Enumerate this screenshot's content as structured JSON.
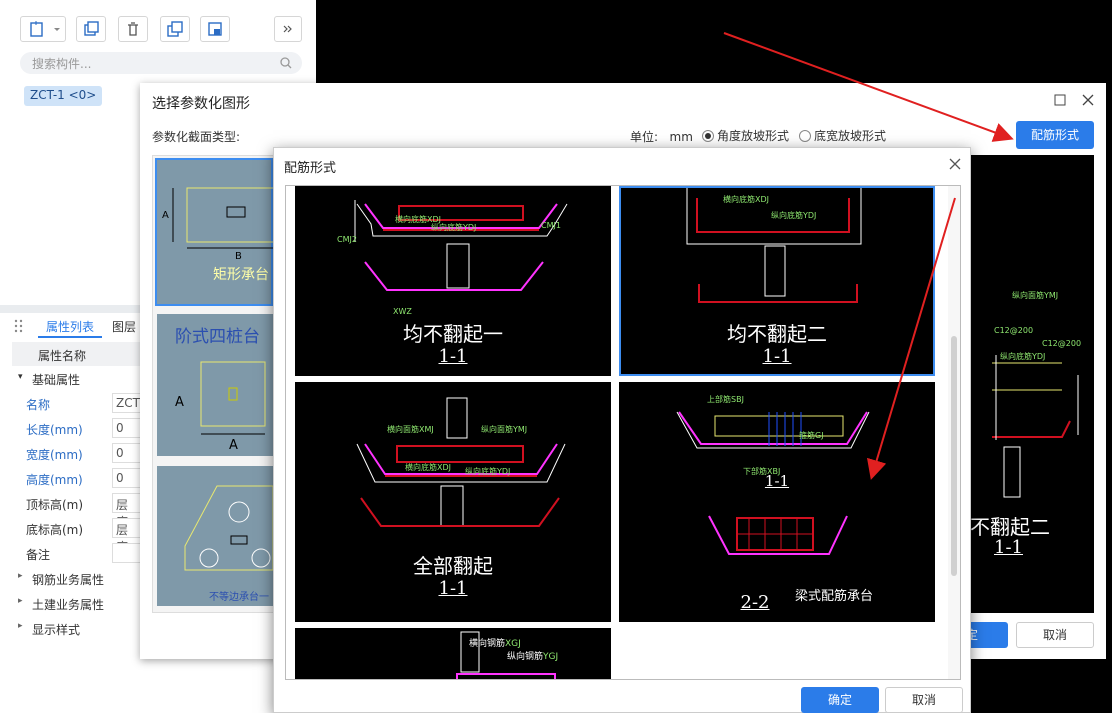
{
  "left_panel": {
    "search_placeholder": "搜索构件...",
    "component": "ZCT-1 <0>",
    "tabs": [
      "属性列表",
      "图层"
    ],
    "prop_header": "属性名称",
    "group_basic": "基础属性",
    "props": [
      {
        "name": "名称",
        "value": "ZCT"
      },
      {
        "name": "长度(mm)",
        "value": "0"
      },
      {
        "name": "宽度(mm)",
        "value": "0"
      },
      {
        "name": "高度(mm)",
        "value": "0"
      },
      {
        "name": "顶标高(m)",
        "value": "层底"
      },
      {
        "name": "底标高(m)",
        "value": "层底"
      },
      {
        "name": "备注",
        "value": ""
      }
    ],
    "groups": [
      "钢筋业务属性",
      "土建业务属性",
      "显示样式"
    ]
  },
  "outer_dialog": {
    "title": "选择参数化图形",
    "section_type_label": "参数化截面类型:",
    "unit_label": "单位:",
    "unit_value": "mm",
    "radio_angle": "角度放坡形式",
    "radio_width": "底宽放坡形式",
    "rebar_button": "配筋形式",
    "ok_fragment": "定",
    "cancel": "取消",
    "shapes": [
      "矩形承台",
      "阶式四桩台",
      "不等边承台一"
    ],
    "preview_title": "不翻起二",
    "preview_section": "1-1",
    "preview_labels": [
      "纵向面筋YMJ",
      "C12@200",
      "纵向底筋YDJ",
      "C12@200"
    ]
  },
  "inner_dialog": {
    "title": "配筋形式",
    "ok": "确定",
    "cancel": "取消",
    "options": [
      {
        "title": "均不翻起一",
        "section": "1-1"
      },
      {
        "title": "均不翻起二",
        "section": "1-1"
      },
      {
        "title": "全部翻起",
        "section": "1-1"
      },
      {
        "title": "梁式配筋承台",
        "section": "2-2",
        "section_top": "1-1"
      }
    ],
    "cad_labels": {
      "hdj": "横向底筋",
      "hdj_code": "XDJ",
      "ydj": "纵向底筋",
      "ydj_code": "YDJ",
      "hmj": "横向面筋",
      "hmj_code": "XMJ",
      "ymj": "纵向面筋",
      "ymj_code": "YMJ",
      "hgj": "横向钢筋",
      "hgj_code": "XGJ",
      "ygj": "纵向钢筋",
      "ygj_code": "YGJ",
      "sbj": "上部筋",
      "sbj_code": "SBJ",
      "xbj": "下部筋",
      "xbj_code": "XBJ",
      "cmj1": "CMJ1",
      "cmj2": "CMJ2",
      "xwz": "XWZ",
      "gj": "箍筋",
      "gj_code": "GJ"
    }
  }
}
